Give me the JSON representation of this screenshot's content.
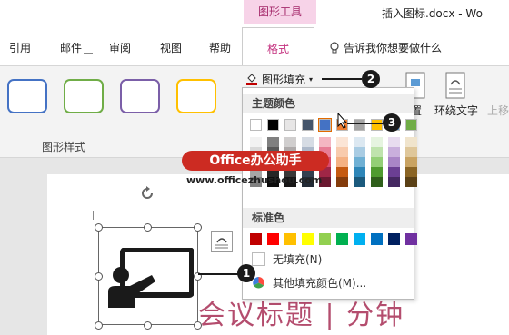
{
  "title_bar": {
    "context_group": "图形工具",
    "doc_title": "插入图标.docx  -  Wo"
  },
  "tabs": [
    "引用",
    "邮件",
    "审阅",
    "视图",
    "帮助"
  ],
  "active_tab": "格式",
  "tell_me": "告诉我你想要做什么",
  "ribbon": {
    "style_colors": [
      "#4472c4",
      "#70ad47",
      "#7b5fa8",
      "#ffc000"
    ],
    "styles_group_label": "图形样式",
    "fill_button_label": "图形填充",
    "position_label": "置",
    "wrap_text_label": "环绕文字",
    "bring_forward_label": "上移"
  },
  "dropdown": {
    "theme_header": "主题颜色",
    "standard_header": "标准色",
    "no_fill_label": "无填充(N)",
    "more_colors_label": "其他填充颜色(M)...",
    "theme_colors": [
      "#ffffff",
      "#000000",
      "#e7e6e6",
      "#44546a",
      "#4472c4",
      "#ed7d31",
      "#a5a5a5",
      "#ffc000",
      "#5b9bd5",
      "#70ad47"
    ],
    "shades": [
      [
        "#f2f2f2",
        "#d9d9d9",
        "#bfbfbf",
        "#a6a6a6",
        "#808080"
      ],
      [
        "#808080",
        "#595959",
        "#404040",
        "#262626",
        "#0d0d0d"
      ],
      [
        "#d0cece",
        "#aeaaaa",
        "#757171",
        "#3a3838",
        "#171616"
      ],
      [
        "#d6dce4",
        "#adb9ca",
        "#8496b0",
        "#333f4f",
        "#222a35"
      ],
      [
        "#f4b6c2",
        "#e77c95",
        "#d94b6c",
        "#a02646",
        "#6a1830"
      ],
      [
        "#fbe5d6",
        "#f8cbad",
        "#f4b183",
        "#c55a11",
        "#843c0c"
      ],
      [
        "#dce8f1",
        "#a9cce3",
        "#6fb0d4",
        "#2e86b8",
        "#1b5a7d"
      ],
      [
        "#e6f4e0",
        "#bfe3ad",
        "#93cf76",
        "#4f9b2f",
        "#2f5f1b"
      ],
      [
        "#e8dcef",
        "#c9afdc",
        "#a985c6",
        "#6b3f93",
        "#452861"
      ],
      [
        "#f0e4cc",
        "#dfc79a",
        "#c9a362",
        "#8a6424",
        "#5a4015"
      ]
    ],
    "standard_colors": [
      "#c00000",
      "#ff0000",
      "#ffc000",
      "#ffff00",
      "#92d050",
      "#00b050",
      "#00b0f0",
      "#0070c0",
      "#002060",
      "#7030a0"
    ]
  },
  "document": {
    "heading": "会议标题 | 分钟"
  },
  "watermark": {
    "brand": "Office办公助手",
    "url": "www.officezhushou.com"
  },
  "callouts": [
    "1",
    "2",
    "3"
  ]
}
